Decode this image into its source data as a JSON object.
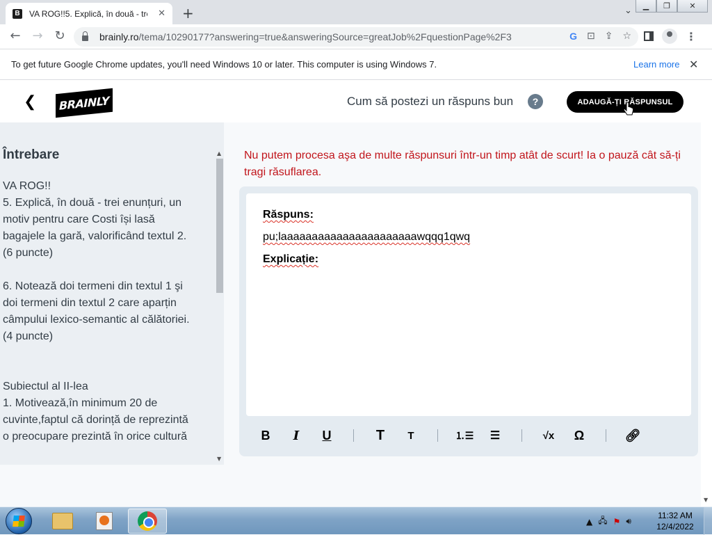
{
  "browser": {
    "tab_title": "VA ROG!!5. Explică, în două - trei",
    "tab_close": "✕",
    "new_tab": "+",
    "url_domain": "brainly.ro",
    "url_path": "/tema/10290177?answering=true&answeringSource=greatJob%2FquestionPage%2F3",
    "infobar_message": "To get future Google Chrome updates, you'll need Windows 10 or later. This computer is using Windows 7.",
    "learn_more": "Learn more"
  },
  "header": {
    "logo_text": "BRAINLY",
    "howto_text": "Cum să postezi un răspuns bun",
    "help_symbol": "?",
    "add_answer_label": "ADAUGĂ-ȚI RĂSPUNSUL"
  },
  "question": {
    "title": "Întrebare",
    "lines": [
      "VA ROG!!",
      "",
      "5. Explică, în două - trei enunțuri, un",
      "motiv pentru care Costi își lasă",
      "bagajele la gară, valorificând textul 2.",
      "(6 puncte)",
      "",
      "6. Notează doi termeni din textul 1 şi",
      "doi termeni din textul 2 care aparțin",
      "câmpului lexico-semantic al călătoriei.",
      "(4 puncte)",
      "",
      "",
      "Subiectul al II-lea",
      "1. Motivează,în minimum 20 de",
      "cuvinte,faptul că dorință de reprezintă",
      "o preocupare prezintă în orice cultură"
    ]
  },
  "answer": {
    "error_message": "Nu putem procesa aşa de multe răspunsuri într-un timp atât de scurt! Ia o pauză cât să-ți tragi răsuflarea.",
    "label_answer": "Răspuns:",
    "body": "pu;laaaaaaaaaaaaaaaaaaaaaawqqq1qwq",
    "label_explanation": "Explicație:"
  },
  "toolbar": {
    "bold": "B",
    "italic": "I",
    "underline": "U",
    "heading_large": "T",
    "heading_small": "T",
    "equation": "√x",
    "symbol": "Ω"
  },
  "taskbar": {
    "time": "11:32 AM",
    "date": "12/4/2022"
  }
}
